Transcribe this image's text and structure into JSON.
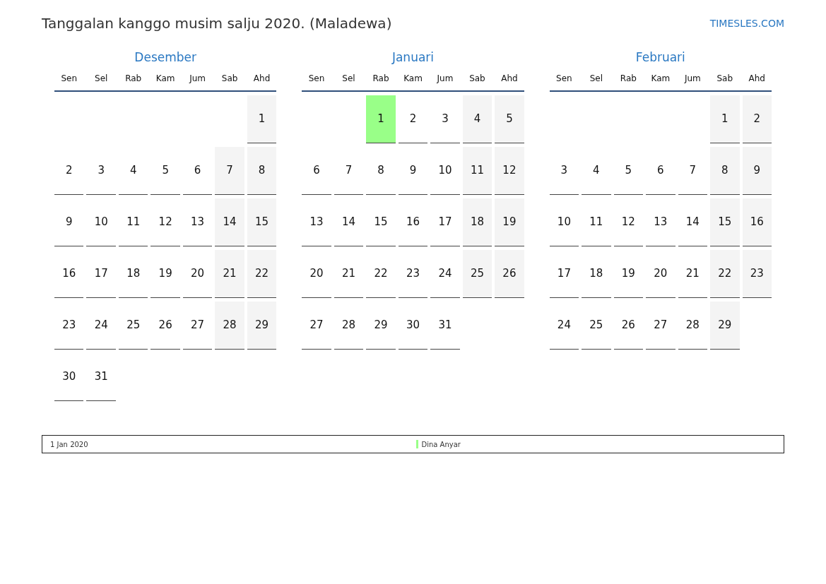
{
  "title": "Tanggalan kanggo musim salju 2020. (Maladewa)",
  "site_link": "TIMESLES.COM",
  "months": [
    {
      "name": "Desember",
      "weekdays": [
        "Sen",
        "Sel",
        "Rab",
        "Kam",
        "Jum",
        "Sab",
        "Ahd"
      ],
      "weeks": [
        {
          "fill_from_end": true,
          "days": [
            {
              "day": "1",
              "kind": "weekend"
            }
          ]
        },
        {
          "days": [
            {
              "day": "2",
              "kind": "weekday"
            },
            {
              "day": "3",
              "kind": "weekday"
            },
            {
              "day": "4",
              "kind": "weekday"
            },
            {
              "day": "5",
              "kind": "weekday"
            },
            {
              "day": "6",
              "kind": "weekday"
            },
            {
              "day": "7",
              "kind": "weekend"
            },
            {
              "day": "8",
              "kind": "weekend"
            }
          ]
        },
        {
          "days": [
            {
              "day": "9",
              "kind": "weekday"
            },
            {
              "day": "10",
              "kind": "weekday"
            },
            {
              "day": "11",
              "kind": "weekday"
            },
            {
              "day": "12",
              "kind": "weekday"
            },
            {
              "day": "13",
              "kind": "weekday"
            },
            {
              "day": "14",
              "kind": "weekend"
            },
            {
              "day": "15",
              "kind": "weekend"
            }
          ]
        },
        {
          "days": [
            {
              "day": "16",
              "kind": "weekday"
            },
            {
              "day": "17",
              "kind": "weekday"
            },
            {
              "day": "18",
              "kind": "weekday"
            },
            {
              "day": "19",
              "kind": "weekday"
            },
            {
              "day": "20",
              "kind": "weekday"
            },
            {
              "day": "21",
              "kind": "weekend"
            },
            {
              "day": "22",
              "kind": "weekend"
            }
          ]
        },
        {
          "days": [
            {
              "day": "23",
              "kind": "weekday"
            },
            {
              "day": "24",
              "kind": "weekday"
            },
            {
              "day": "25",
              "kind": "weekday"
            },
            {
              "day": "26",
              "kind": "weekday"
            },
            {
              "day": "27",
              "kind": "weekday"
            },
            {
              "day": "28",
              "kind": "weekend"
            },
            {
              "day": "29",
              "kind": "weekend"
            }
          ]
        },
        {
          "fill_from_end": false,
          "days": [
            {
              "day": "30",
              "kind": "weekday"
            },
            {
              "day": "31",
              "kind": "weekday"
            }
          ]
        }
      ]
    },
    {
      "name": "Januari",
      "weekdays": [
        "Sen",
        "Sel",
        "Rab",
        "Kam",
        "Jum",
        "Sab",
        "Ahd"
      ],
      "weeks": [
        {
          "fill_from_end": true,
          "days": [
            {
              "day": "1",
              "kind": "holiday",
              "color": "#99ff88"
            },
            {
              "day": "2",
              "kind": "weekday"
            },
            {
              "day": "3",
              "kind": "weekday"
            },
            {
              "day": "4",
              "kind": "weekend"
            },
            {
              "day": "5",
              "kind": "weekend"
            }
          ]
        },
        {
          "days": [
            {
              "day": "6",
              "kind": "weekday"
            },
            {
              "day": "7",
              "kind": "weekday"
            },
            {
              "day": "8",
              "kind": "weekday"
            },
            {
              "day": "9",
              "kind": "weekday"
            },
            {
              "day": "10",
              "kind": "weekday"
            },
            {
              "day": "11",
              "kind": "weekend"
            },
            {
              "day": "12",
              "kind": "weekend"
            }
          ]
        },
        {
          "days": [
            {
              "day": "13",
              "kind": "weekday"
            },
            {
              "day": "14",
              "kind": "weekday"
            },
            {
              "day": "15",
              "kind": "weekday"
            },
            {
              "day": "16",
              "kind": "weekday"
            },
            {
              "day": "17",
              "kind": "weekday"
            },
            {
              "day": "18",
              "kind": "weekend"
            },
            {
              "day": "19",
              "kind": "weekend"
            }
          ]
        },
        {
          "days": [
            {
              "day": "20",
              "kind": "weekday"
            },
            {
              "day": "21",
              "kind": "weekday"
            },
            {
              "day": "22",
              "kind": "weekday"
            },
            {
              "day": "23",
              "kind": "weekday"
            },
            {
              "day": "24",
              "kind": "weekday"
            },
            {
              "day": "25",
              "kind": "weekend"
            },
            {
              "day": "26",
              "kind": "weekend"
            }
          ]
        },
        {
          "fill_from_end": false,
          "days": [
            {
              "day": "27",
              "kind": "weekday"
            },
            {
              "day": "28",
              "kind": "weekday"
            },
            {
              "day": "29",
              "kind": "weekday"
            },
            {
              "day": "30",
              "kind": "weekday"
            },
            {
              "day": "31",
              "kind": "weekday"
            }
          ]
        }
      ]
    },
    {
      "name": "Februari",
      "weekdays": [
        "Sen",
        "Sel",
        "Rab",
        "Kam",
        "Jum",
        "Sab",
        "Ahd"
      ],
      "weeks": [
        {
          "fill_from_end": true,
          "days": [
            {
              "day": "1",
              "kind": "weekend"
            },
            {
              "day": "2",
              "kind": "weekend"
            }
          ]
        },
        {
          "days": [
            {
              "day": "3",
              "kind": "weekday"
            },
            {
              "day": "4",
              "kind": "weekday"
            },
            {
              "day": "5",
              "kind": "weekday"
            },
            {
              "day": "6",
              "kind": "weekday"
            },
            {
              "day": "7",
              "kind": "weekday"
            },
            {
              "day": "8",
              "kind": "weekend"
            },
            {
              "day": "9",
              "kind": "weekend"
            }
          ]
        },
        {
          "days": [
            {
              "day": "10",
              "kind": "weekday"
            },
            {
              "day": "11",
              "kind": "weekday"
            },
            {
              "day": "12",
              "kind": "weekday"
            },
            {
              "day": "13",
              "kind": "weekday"
            },
            {
              "day": "14",
              "kind": "weekday"
            },
            {
              "day": "15",
              "kind": "weekend"
            },
            {
              "day": "16",
              "kind": "weekend"
            }
          ]
        },
        {
          "days": [
            {
              "day": "17",
              "kind": "weekday"
            },
            {
              "day": "18",
              "kind": "weekday"
            },
            {
              "day": "19",
              "kind": "weekday"
            },
            {
              "day": "20",
              "kind": "weekday"
            },
            {
              "day": "21",
              "kind": "weekday"
            },
            {
              "day": "22",
              "kind": "weekend"
            },
            {
              "day": "23",
              "kind": "weekend"
            }
          ]
        },
        {
          "fill_from_end": false,
          "days": [
            {
              "day": "24",
              "kind": "weekday"
            },
            {
              "day": "25",
              "kind": "weekday"
            },
            {
              "day": "26",
              "kind": "weekday"
            },
            {
              "day": "27",
              "kind": "weekday"
            },
            {
              "day": "28",
              "kind": "weekday"
            },
            {
              "day": "29",
              "kind": "weekend"
            }
          ]
        }
      ]
    }
  ],
  "holidays": [
    {
      "date": "1 Jan 2020",
      "name": "Dina Anyar",
      "color": "#99ff88"
    }
  ]
}
